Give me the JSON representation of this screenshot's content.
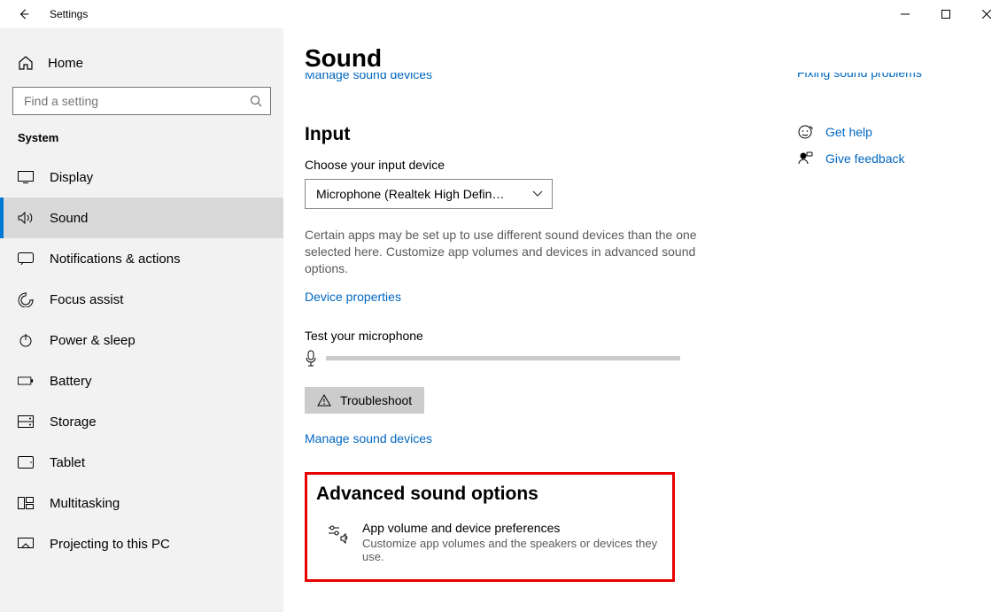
{
  "window": {
    "app_title": "Settings"
  },
  "sidebar": {
    "home_label": "Home",
    "search_placeholder": "Find a setting",
    "category": "System",
    "items": [
      {
        "label": "Display"
      },
      {
        "label": "Sound"
      },
      {
        "label": "Notifications & actions"
      },
      {
        "label": "Focus assist"
      },
      {
        "label": "Power & sleep"
      },
      {
        "label": "Battery"
      },
      {
        "label": "Storage"
      },
      {
        "label": "Tablet"
      },
      {
        "label": "Multitasking"
      },
      {
        "label": "Projecting to this PC"
      }
    ]
  },
  "main": {
    "page_title": "Sound",
    "truncated_link_top": "Manage sound devices",
    "input_section": {
      "heading": "Input",
      "choose_label": "Choose your input device",
      "selected_device": "Microphone (Realtek High Definitio...",
      "help_text": "Certain apps may be set up to use different sound devices than the one selected here. Customize app volumes and devices in advanced sound options.",
      "device_properties": "Device properties",
      "test_label": "Test your microphone",
      "troubleshoot": "Troubleshoot",
      "manage_link": "Manage sound devices"
    },
    "advanced": {
      "heading": "Advanced sound options",
      "item_title": "App volume and device preferences",
      "item_desc": "Customize app volumes and the speakers or devices they use."
    }
  },
  "right": {
    "truncated_link": "Fixing sound problems",
    "get_help": "Get help",
    "give_feedback": "Give feedback"
  }
}
